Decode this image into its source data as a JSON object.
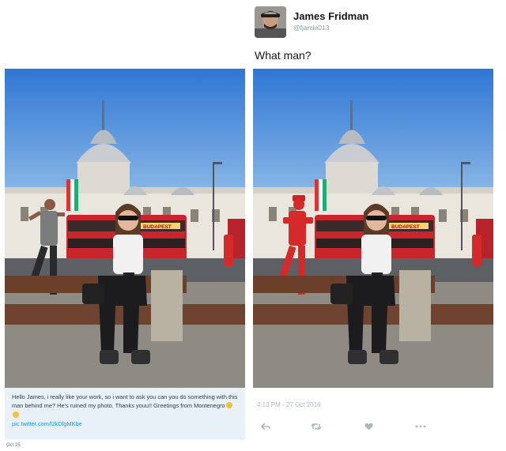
{
  "original_tweet": {
    "message": "Hello James, i really like your work, so i want to ask you can you do something with this man behind me? He's ruined my photo. Thanks youu!! Greetings from Montenegro",
    "link": "pic.twitter.com/l2kDlgMKbe",
    "date": "Oct 25",
    "bus_sign": "BUDAPEST"
  },
  "reply_tweet": {
    "author_name": "James Fridman",
    "author_handle": "@fjamie013",
    "text": "What man?",
    "timestamp": "4:13 PM - 27 Oct 2016",
    "bus_sign": "BUDAPEST",
    "actions": [
      "reply-icon",
      "retweet-icon",
      "like-icon",
      "more-icon"
    ]
  },
  "colors": {
    "link": "#1b95e0",
    "sky": "#3a7fd0",
    "bus_red": "#c8252c",
    "bench_brown": "#6b3f2a",
    "card_bg": "#e8f0f8",
    "meta_gray": "#aab8c2"
  }
}
